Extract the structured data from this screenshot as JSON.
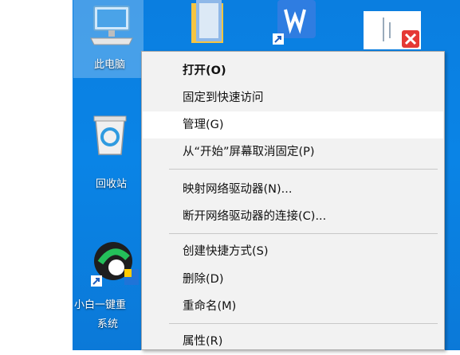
{
  "desktop_icons": [
    {
      "label": "此电脑",
      "icon": "computer-icon"
    },
    {
      "label": "回收站",
      "icon": "recycle-bin-icon"
    },
    {
      "label_line1": "小白一键重",
      "label_line2": "系统",
      "icon": "xiaobai-app-icon"
    },
    {
      "icon": "folder-icon"
    },
    {
      "icon": "wps-writer-icon"
    },
    {
      "icon": "document-error-icon"
    }
  ],
  "context_menu": {
    "items": [
      {
        "label": "打开(O)",
        "bold": true
      },
      {
        "label": "固定到快速访问"
      },
      {
        "label": "管理(G)",
        "highlighted": true
      },
      {
        "label": "从“开始”屏幕取消固定(P)"
      },
      {
        "separator": true
      },
      {
        "label": "映射网络驱动器(N)..."
      },
      {
        "label": "断开网络驱动器的连接(C)..."
      },
      {
        "separator": true
      },
      {
        "label": "创建快捷方式(S)"
      },
      {
        "label": "删除(D)"
      },
      {
        "label": "重命名(M)"
      },
      {
        "separator": true
      },
      {
        "label": "属性(R)"
      }
    ]
  },
  "colors": {
    "desktop_blue": "#0a7ee0",
    "menu_bg": "#f2f2f2",
    "menu_hover": "#ffffff"
  }
}
